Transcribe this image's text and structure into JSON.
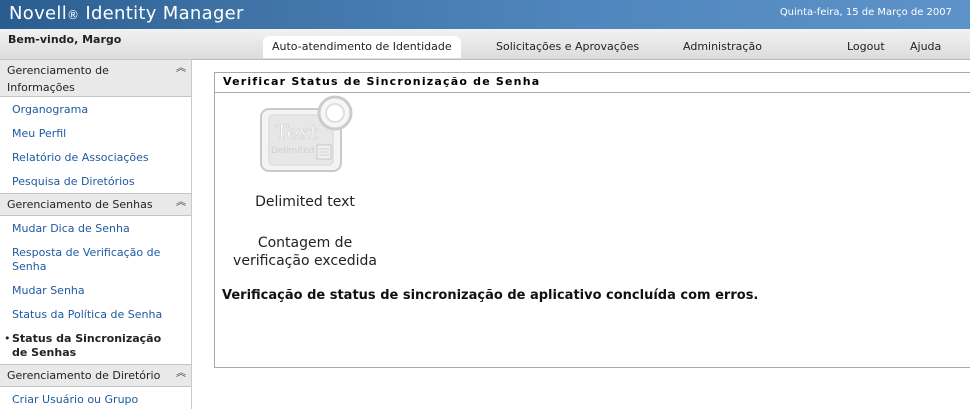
{
  "header": {
    "brand_name": "Novell",
    "brand_reg": "®",
    "brand_product": " Identity Manager",
    "date": "Quinta-feira, 15 de Março de 2007",
    "welcome": "Bem-vindo, Margo"
  },
  "nav": {
    "tabs": [
      {
        "label": "Auto-atendimento de Identidade",
        "active": true
      },
      {
        "label": "Solicitações e Aprovações",
        "active": false
      },
      {
        "label": "Administração",
        "active": false
      }
    ],
    "logout": "Logout",
    "help": "Ajuda"
  },
  "sidebar": {
    "sections": [
      {
        "title": "Gerenciamento de Informações",
        "items": [
          "Organograma",
          "Meu Perfil",
          "Relatório de Associações",
          "Pesquisa de Diretórios"
        ]
      },
      {
        "title": "Gerenciamento de Senhas",
        "items": [
          "Mudar Dica de Senha",
          "Resposta de Verificação de Senha",
          "Mudar Senha",
          "Status da Política de Senha",
          "Status da Sincronização de Senhas"
        ]
      },
      {
        "title": "Gerenciamento de Diretório",
        "items": [
          "Criar Usuário ou Grupo"
        ]
      }
    ],
    "current_item": "Status da Sincronização de Senhas",
    "current_bullet": "•",
    "collapse_glyph": "≈"
  },
  "panel": {
    "title": "Verificar Status de Sincronização de Senha",
    "icon_label_top": "Text",
    "icon_label_bottom": "Delimited",
    "icon_caption": "Delimited text",
    "count_label": "Contagem de verificação excedida",
    "count_label_line1": "Contagem de",
    "count_label_line2": "verificação excedida",
    "result_message": "Verificação de status de sincronização de aplicativo concluída com erros."
  },
  "colors": {
    "header_blue": "#3f73a6",
    "link_blue": "#1f5aa0"
  }
}
